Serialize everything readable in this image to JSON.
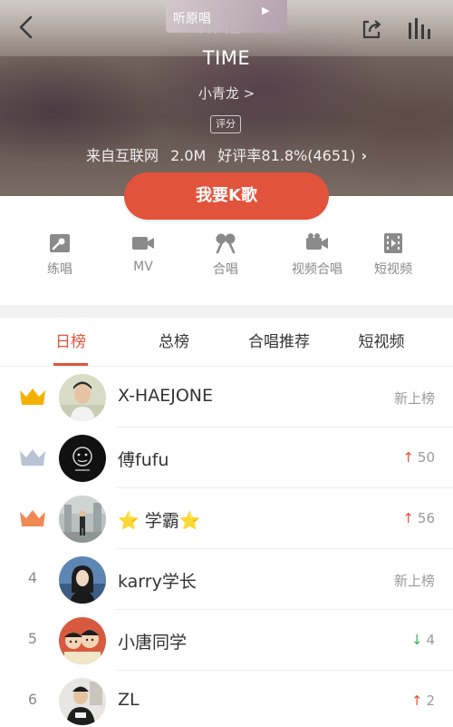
{
  "header": {
    "original_label": "听原唱",
    "ghost_title": "TIME",
    "song_title": "TIME",
    "singer": "小青龙 >",
    "rating_badge": "评分",
    "source": "来自互联网",
    "size": "2.0M",
    "rating": "好评率81.8%(4651)",
    "k_button": "我要K歌"
  },
  "actions": [
    {
      "label": "练唱",
      "icon": "practice-icon"
    },
    {
      "label": "MV",
      "icon": "video-camera-icon"
    },
    {
      "label": "合唱",
      "icon": "duet-mic-icon"
    },
    {
      "label": "视频合唱",
      "icon": "video-duet-icon"
    },
    {
      "label": "短视频",
      "icon": "short-video-icon"
    }
  ],
  "tabs": [
    {
      "label": "日榜",
      "active": true
    },
    {
      "label": "总榜",
      "active": false
    },
    {
      "label": "合唱推荐",
      "active": false
    },
    {
      "label": "短视频",
      "active": false
    }
  ],
  "ranking": [
    {
      "rank": "1",
      "rank_icon": "gold-crown-icon",
      "name": "X-HAEJONE",
      "trend_dir": "new",
      "trend": "新上榜"
    },
    {
      "rank": "2",
      "rank_icon": "silver-crown-icon",
      "name": "傅fufu",
      "trend_dir": "up",
      "trend": "50"
    },
    {
      "rank": "3",
      "rank_icon": "bronze-crown-icon",
      "name": "学霸",
      "name_prefix": "⭐",
      "name_suffix": "⭐",
      "trend_dir": "up",
      "trend": "56"
    },
    {
      "rank": "4",
      "name": "karry学长",
      "trend_dir": "new",
      "trend": "新上榜"
    },
    {
      "rank": "5",
      "name": "小唐同学",
      "trend_dir": "down",
      "trend": "4"
    },
    {
      "rank": "6",
      "name": "ZL",
      "trend_dir": "up",
      "trend": "2"
    }
  ],
  "colors": {
    "accent": "#e2533c",
    "gold": "#f3b200",
    "silver": "#b8c4d4",
    "bronze": "#f08a55",
    "down": "#3fae5a"
  }
}
